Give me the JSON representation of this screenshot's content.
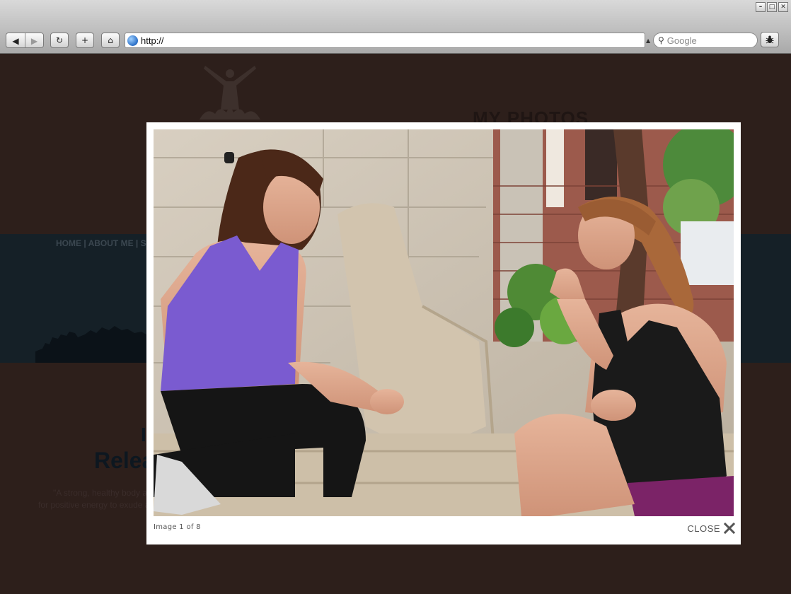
{
  "browser": {
    "address": "http://",
    "search_placeholder": "Google",
    "buttons": {
      "back": "◀",
      "forward": "▶",
      "reload": "↻",
      "add": "+",
      "home": "⌂"
    },
    "window_controls": [
      "–",
      "□",
      "✕"
    ]
  },
  "background_page": {
    "title": "MY PHOTOS",
    "nav": "HOME | ABOUT ME | SERVI",
    "heading_1": "I",
    "heading_2": "Releas",
    "quote_line_1": "\"A strong, healthy body all",
    "quote_line_2": "for positive energy to exude and"
  },
  "lightbox": {
    "caption": "Image 1 of 8",
    "close_label": "CLOSE",
    "photo_icon": "photo-two-women-exercising"
  },
  "colors": {
    "page_bg": "#2d1f1b",
    "band": "#152027",
    "shirt_left": "#7a5bd0",
    "shirt_right": "#1a1a1a"
  }
}
